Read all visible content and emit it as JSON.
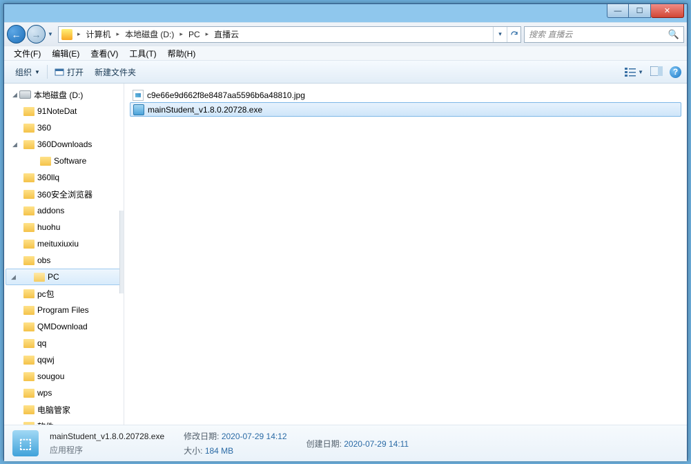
{
  "titlebar": {
    "min": "—",
    "max": "☐",
    "close": "✕"
  },
  "breadcrumb": {
    "computer": "计算机",
    "drive": "本地磁盘 (D:)",
    "f1": "PC",
    "f2": "直播云"
  },
  "search": {
    "placeholder": "搜索 直播云"
  },
  "menu": {
    "file": "文件(F)",
    "edit": "编辑(E)",
    "view": "查看(V)",
    "tools": "工具(T)",
    "help": "帮助(H)"
  },
  "toolbar": {
    "organize": "组织",
    "open": "打开",
    "newfolder": "新建文件夹"
  },
  "tree": {
    "root": "本地磁盘 (D:)",
    "items": [
      "91NoteDat",
      "360",
      "360Downloads",
      "Software",
      "360llq",
      "360安全浏览器",
      "addons",
      "huohu",
      "meituxiuxiu",
      "obs",
      "PC",
      "pc包",
      "Program Files",
      "QMDownload",
      "qq",
      "qqwj",
      "sougou",
      "wps",
      "电脑管家",
      "软件"
    ]
  },
  "files": [
    {
      "name": "c9e66e9d662f8e8487aa5596b6a48810.jpg",
      "type": "jpg",
      "selected": false
    },
    {
      "name": "mainStudent_v1.8.0.20728.exe",
      "type": "exe",
      "selected": true
    }
  ],
  "details": {
    "name": "mainStudent_v1.8.0.20728.exe",
    "type": "应用程序",
    "modlabel": "修改日期:",
    "moddate": "2020-07-29 14:12",
    "createlabel": "创建日期:",
    "createdate": "2020-07-29 14:11",
    "sizelabel": "大小:",
    "size": "184 MB"
  }
}
